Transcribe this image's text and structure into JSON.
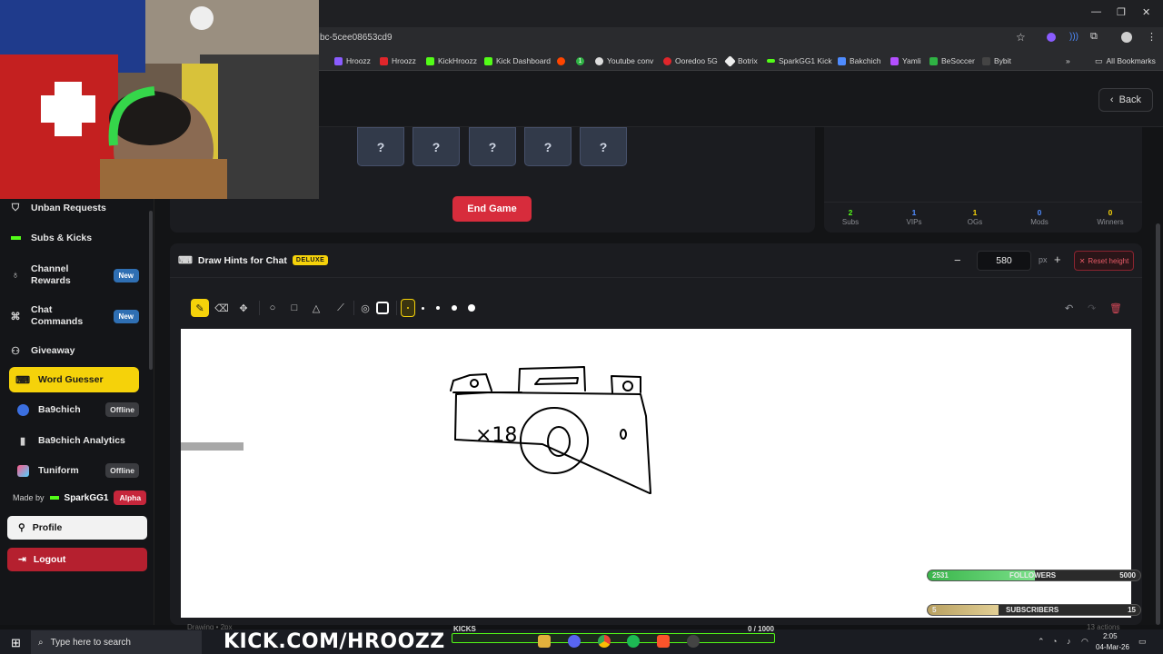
{
  "browser": {
    "address": "bc-5cee08653cd9",
    "bookmarks": [
      "Hroozz",
      "Hroozz",
      "KickHroozz",
      "Kick Dashboard",
      "Youtube conv",
      "Ooredoo 5G",
      "Botrix",
      "SparkGG1 Kick",
      "Bakchich",
      "Yamli",
      "BeSoccer",
      "Bybit"
    ],
    "all_bookmarks": "All Bookmarks",
    "bookmark_number": "1"
  },
  "header": {
    "back_label": "Back"
  },
  "sidebar": {
    "items": [
      {
        "label": "Unban Requests",
        "icon": "shield-icon"
      },
      {
        "label": "Subs & Kicks",
        "icon": "kick-icon"
      },
      {
        "label": "Channel Rewards",
        "icon": "award-icon",
        "badge": "New"
      },
      {
        "label": "Chat Commands",
        "icon": "command-icon",
        "badge": "New"
      },
      {
        "label": "Giveaway",
        "icon": "gift-icon"
      },
      {
        "label": "Word Guesser",
        "icon": "gamepad-icon",
        "active": true
      },
      {
        "label": "Ba9chich",
        "icon": "ba9chich-icon",
        "badge": "Offline"
      },
      {
        "label": "Ba9chich Analytics",
        "icon": "chart-icon"
      },
      {
        "label": "Tuniform",
        "icon": "tuniform-icon",
        "badge": "Offline"
      }
    ],
    "made_by": "Made by",
    "author": "SparkGG1",
    "alpha": "Alpha",
    "profile": "Profile",
    "logout": "Logout"
  },
  "game": {
    "hidden_letters": [
      "?",
      "?",
      "?",
      "?",
      "?"
    ],
    "end_game": "End Game"
  },
  "stats": [
    {
      "value": "2",
      "label": "Subs",
      "color": "#53fc18"
    },
    {
      "value": "1",
      "label": "VIPs",
      "color": "#4f8cff"
    },
    {
      "value": "1",
      "label": "OGs",
      "color": "#f5d20a"
    },
    {
      "value": "0",
      "label": "Mods",
      "color": "#4f8cff"
    },
    {
      "value": "0",
      "label": "Winners",
      "color": "#f5d20a"
    }
  ],
  "draw": {
    "title": "Draw Hints for Chat",
    "badge": "DELUXE",
    "height": "580",
    "unit": "px",
    "reset": "Reset height",
    "status": "Drawing • 2px",
    "actions": "13 actions",
    "sketch_text": "×18"
  },
  "overlay": {
    "followers": {
      "label": "FOLLOWERS",
      "current": "2531",
      "goal": "5000",
      "progress": 0.506
    },
    "subscribers": {
      "label": "SUBSCRIBERS",
      "current": "5",
      "goal": "15",
      "progress": 0.333
    },
    "kick_url": "KICK.COM/HROOZZ",
    "kicks_label": "KICKS",
    "kicks_count": "0 / 1000",
    "kicks_progress": 0
  },
  "taskbar": {
    "search_placeholder": "Type here to search",
    "time": "2:05",
    "date": "04-Mar-26"
  },
  "colors": {
    "accent": "#f5d20a",
    "danger": "#d72c3c",
    "kick_green": "#53fc18"
  }
}
